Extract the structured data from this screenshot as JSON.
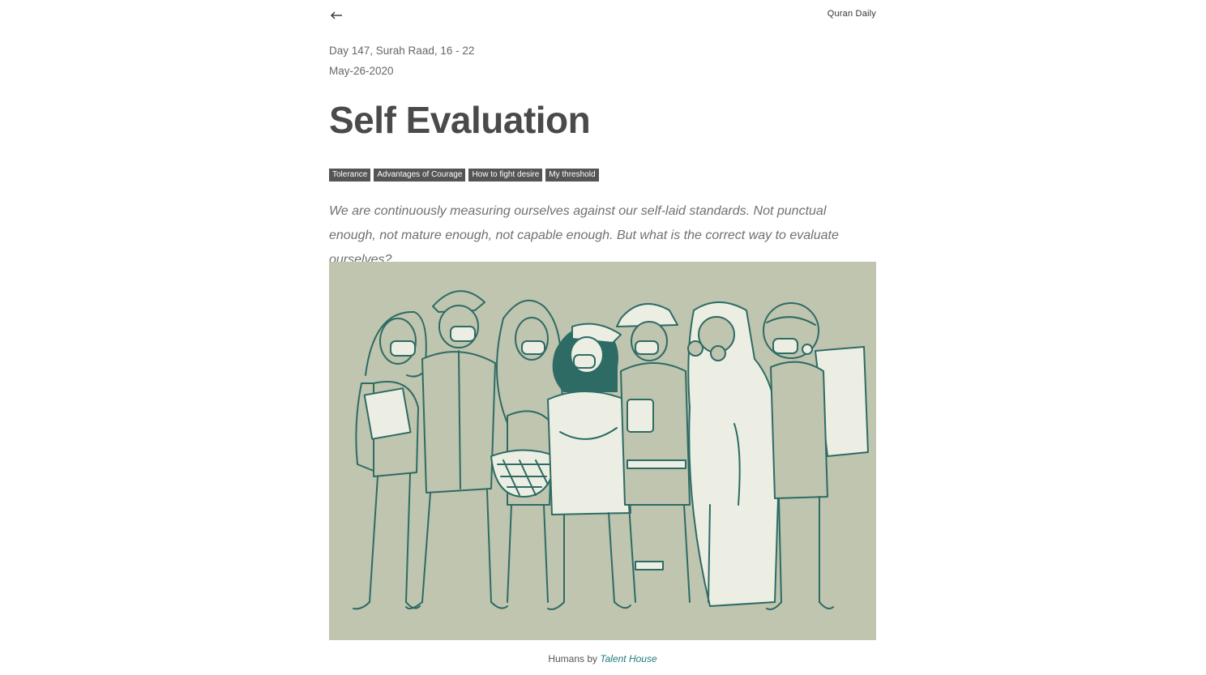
{
  "header": {
    "site_name": "Quran Daily",
    "back_icon": "arrow-left-icon"
  },
  "post": {
    "day_line": "Day 147, Surah Raad, 16 - 22",
    "date": "May-26-2020",
    "title": "Self Evaluation",
    "tags": [
      "Tolerance",
      "Advantages of Courage",
      "How to fight desire",
      "My threshold"
    ],
    "excerpt": "We are continuously measuring ourselves against our self-laid standards. Not punctual enough, not mature enough, not capable enough. But what is the correct way to evaluate ourselves?"
  },
  "image": {
    "caption_prefix": "Humans by",
    "credit_link": "Talent House",
    "background_color": "#bfc5ae",
    "stroke_color": "#2e6b65",
    "fill_color": "#eceee3"
  }
}
